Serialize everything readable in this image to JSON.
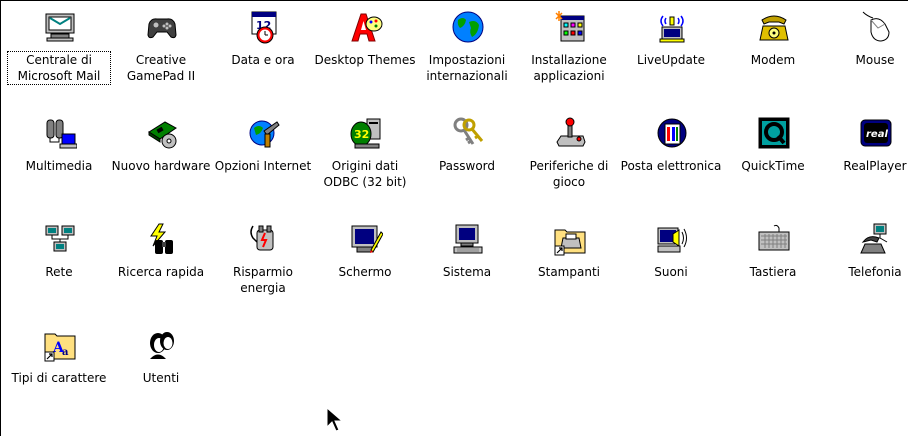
{
  "items": [
    {
      "label": "Centrale di Microsoft Mail",
      "icon": "mail-center-icon",
      "selected": true
    },
    {
      "label": "Creative GamePad II",
      "icon": "gamepad-icon"
    },
    {
      "label": "Data e ora",
      "icon": "calendar-clock-icon"
    },
    {
      "label": "Desktop Themes",
      "icon": "desktop-themes-icon"
    },
    {
      "label": "Impostazioni internazionali",
      "icon": "globe-icon"
    },
    {
      "label": "Installazione applicazioni",
      "icon": "install-apps-icon"
    },
    {
      "label": "LiveUpdate",
      "icon": "liveupdate-icon"
    },
    {
      "label": "Modem",
      "icon": "modem-phone-icon"
    },
    {
      "label": "Mouse",
      "icon": "mouse-icon"
    },
    {
      "label": "Multimedia",
      "icon": "multimedia-icon"
    },
    {
      "label": "Nuovo hardware",
      "icon": "new-hardware-icon"
    },
    {
      "label": "Opzioni Internet",
      "icon": "internet-options-icon"
    },
    {
      "label": "Origini dati ODBC (32 bit)",
      "icon": "odbc-icon"
    },
    {
      "label": "Password",
      "icon": "keys-icon"
    },
    {
      "label": "Periferiche di gioco",
      "icon": "joystick-icon"
    },
    {
      "label": "Posta elettronica",
      "icon": "email-icon"
    },
    {
      "label": "QuickTime",
      "icon": "quicktime-icon"
    },
    {
      "label": "RealPlayer",
      "icon": "realplayer-icon"
    },
    {
      "label": "Rete",
      "icon": "network-icon"
    },
    {
      "label": "Ricerca rapida",
      "icon": "binoculars-icon"
    },
    {
      "label": "Risparmio energia",
      "icon": "power-plug-icon"
    },
    {
      "label": "Schermo",
      "icon": "display-icon"
    },
    {
      "label": "Sistema",
      "icon": "computer-icon"
    },
    {
      "label": "Stampanti",
      "icon": "printer-folder-icon"
    },
    {
      "label": "Suoni",
      "icon": "speaker-icon"
    },
    {
      "label": "Tastiera",
      "icon": "keyboard-icon"
    },
    {
      "label": "Telefonia",
      "icon": "telephony-icon"
    },
    {
      "label": "Tipi di carattere",
      "icon": "fonts-folder-icon"
    },
    {
      "label": "Utenti",
      "icon": "users-icon"
    }
  ]
}
